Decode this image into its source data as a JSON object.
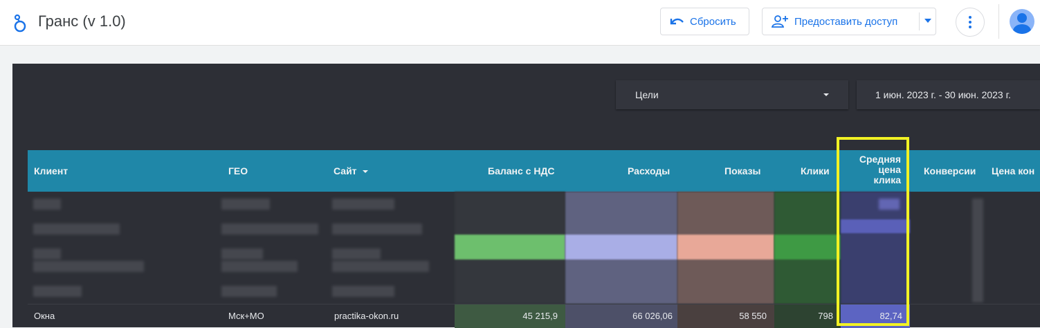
{
  "header": {
    "title": "Гранс (v 1.0)",
    "reset_label": "Сбросить",
    "share_label": "Предоставить доступ"
  },
  "filters": {
    "goals_label": "Цели",
    "date_range": "1 июн. 2023 г. - 30 июн. 2023 г."
  },
  "table": {
    "columns": [
      "Клиент",
      "ГЕО",
      "Сайт",
      "Баланс с НДС",
      "Расходы",
      "Показы",
      "Клики",
      "Средняя цена клика",
      "Конверсии",
      "Цена кон"
    ],
    "avg_cpc_lines": [
      "Средняя",
      "цена",
      "клика"
    ],
    "last_row": {
      "client": "Окна",
      "geo": "Мск+МО",
      "site": "practika-okon.ru",
      "balance": "45 215,9",
      "expenses": "66 026,06",
      "impressions": "58 550",
      "clicks": "798",
      "avg_cpc": "82,74"
    }
  },
  "colors": {
    "accent": "#1a73e8",
    "header_band": "#1f87a8",
    "report_bg": "#2d2f36",
    "highlight": "#f2f224"
  },
  "icons": {
    "app": "looker-studio-icon",
    "reset": "undo-icon",
    "share": "person-add-icon",
    "more": "more-vert-icon",
    "avatar": "account-avatar"
  }
}
